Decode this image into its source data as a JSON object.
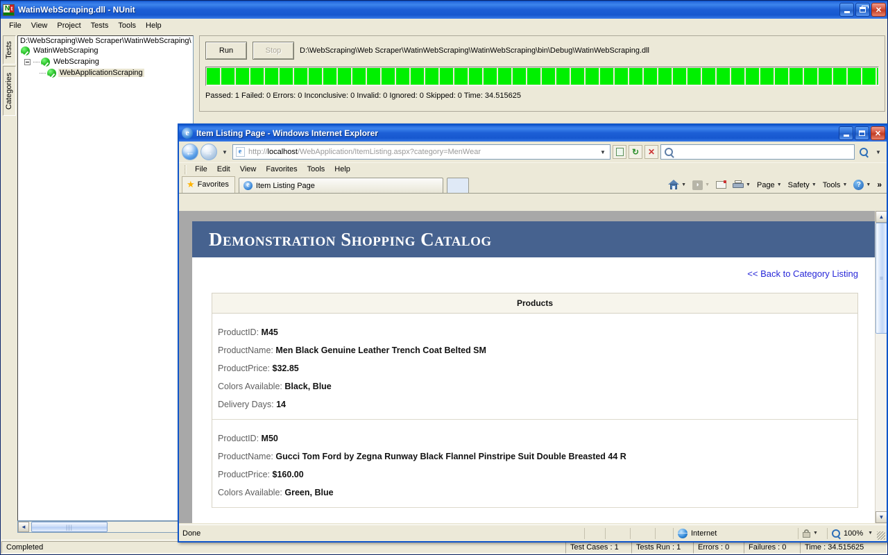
{
  "nunit": {
    "title": "WatinWebScraping.dll - NUnit",
    "icon": "nunit-icon",
    "menu": [
      "File",
      "View",
      "Project",
      "Tests",
      "Tools",
      "Help"
    ],
    "window_buttons": {
      "minimize": "minimize-button",
      "restore": "restore-button",
      "close": "close-button"
    },
    "tabs": [
      "Tests",
      "Categories"
    ],
    "tree": {
      "path": "D:\\WebScraping\\Web Scraper\\WatinWebScraping\\",
      "nodes": [
        {
          "label": "WatinWebScraping",
          "level": 0,
          "selected": false
        },
        {
          "label": "WebScraping",
          "level": 1,
          "selected": false
        },
        {
          "label": "WebApplicationScraping",
          "level": 2,
          "selected": true
        }
      ]
    },
    "run_button": "Run",
    "stop_button": "Stop",
    "assembly_path": "D:\\WebScraping\\Web Scraper\\WatinWebScraping\\WatinWebScraping\\bin\\Debug\\WatinWebScraping.dll",
    "progress": {
      "color": "#00f000",
      "segments": 48
    },
    "summary": "Passed: 1  Failed: 0  Errors: 0  Inconclusive: 0  Invalid: 0  Ignored: 0  Skipped: 0  Time: 34.515625",
    "status": {
      "message": "Completed",
      "test_cases": "Test Cases : 1",
      "tests_run": "Tests Run : 1",
      "errors": "Errors : 0",
      "failures": "Failures : 0",
      "time": "Time : 34.515625"
    }
  },
  "ie": {
    "title": "Item Listing Page - Windows Internet Explorer",
    "window_buttons": {
      "minimize": "minimize-button",
      "maximize": "maximize-button",
      "close": "close-button"
    },
    "address": {
      "scheme": "http://",
      "host": "localhost",
      "path": "/WebApplication/ItemListing.aspx?category=MenWear",
      "full": "http://localhost/WebApplication/ItemListing.aspx?category=MenWear"
    },
    "search_placeholder": "",
    "menu": [
      "File",
      "Edit",
      "View",
      "Favorites",
      "Tools",
      "Help"
    ],
    "favorites_label": "Favorites",
    "tab_label": "Item Listing Page",
    "command_bar": [
      "Page",
      "Safety",
      "Tools"
    ],
    "status": {
      "message": "Done",
      "zone": "Internet",
      "zoom": "100%"
    }
  },
  "page": {
    "header_title": "Demonstration Shopping Catalog",
    "header_color": "#46628f",
    "back_link": "<< Back to Category Listing",
    "table_header": "Products",
    "field_labels": {
      "id": "ProductID:",
      "name": "ProductName:",
      "price": "ProductPrice:",
      "colors": "Colors Available:",
      "delivery": "Delivery Days:"
    },
    "products": [
      {
        "id": "M45",
        "name": "Men Black Genuine Leather Trench Coat Belted SM",
        "price": "$32.85",
        "colors": "Black, Blue",
        "delivery": "14"
      },
      {
        "id": "M50",
        "name": "Gucci Tom Ford by Zegna Runway Black Flannel Pinstripe Suit Double Breasted 44 R",
        "price": "$160.00",
        "colors": "Green, Blue",
        "delivery": ""
      }
    ]
  }
}
